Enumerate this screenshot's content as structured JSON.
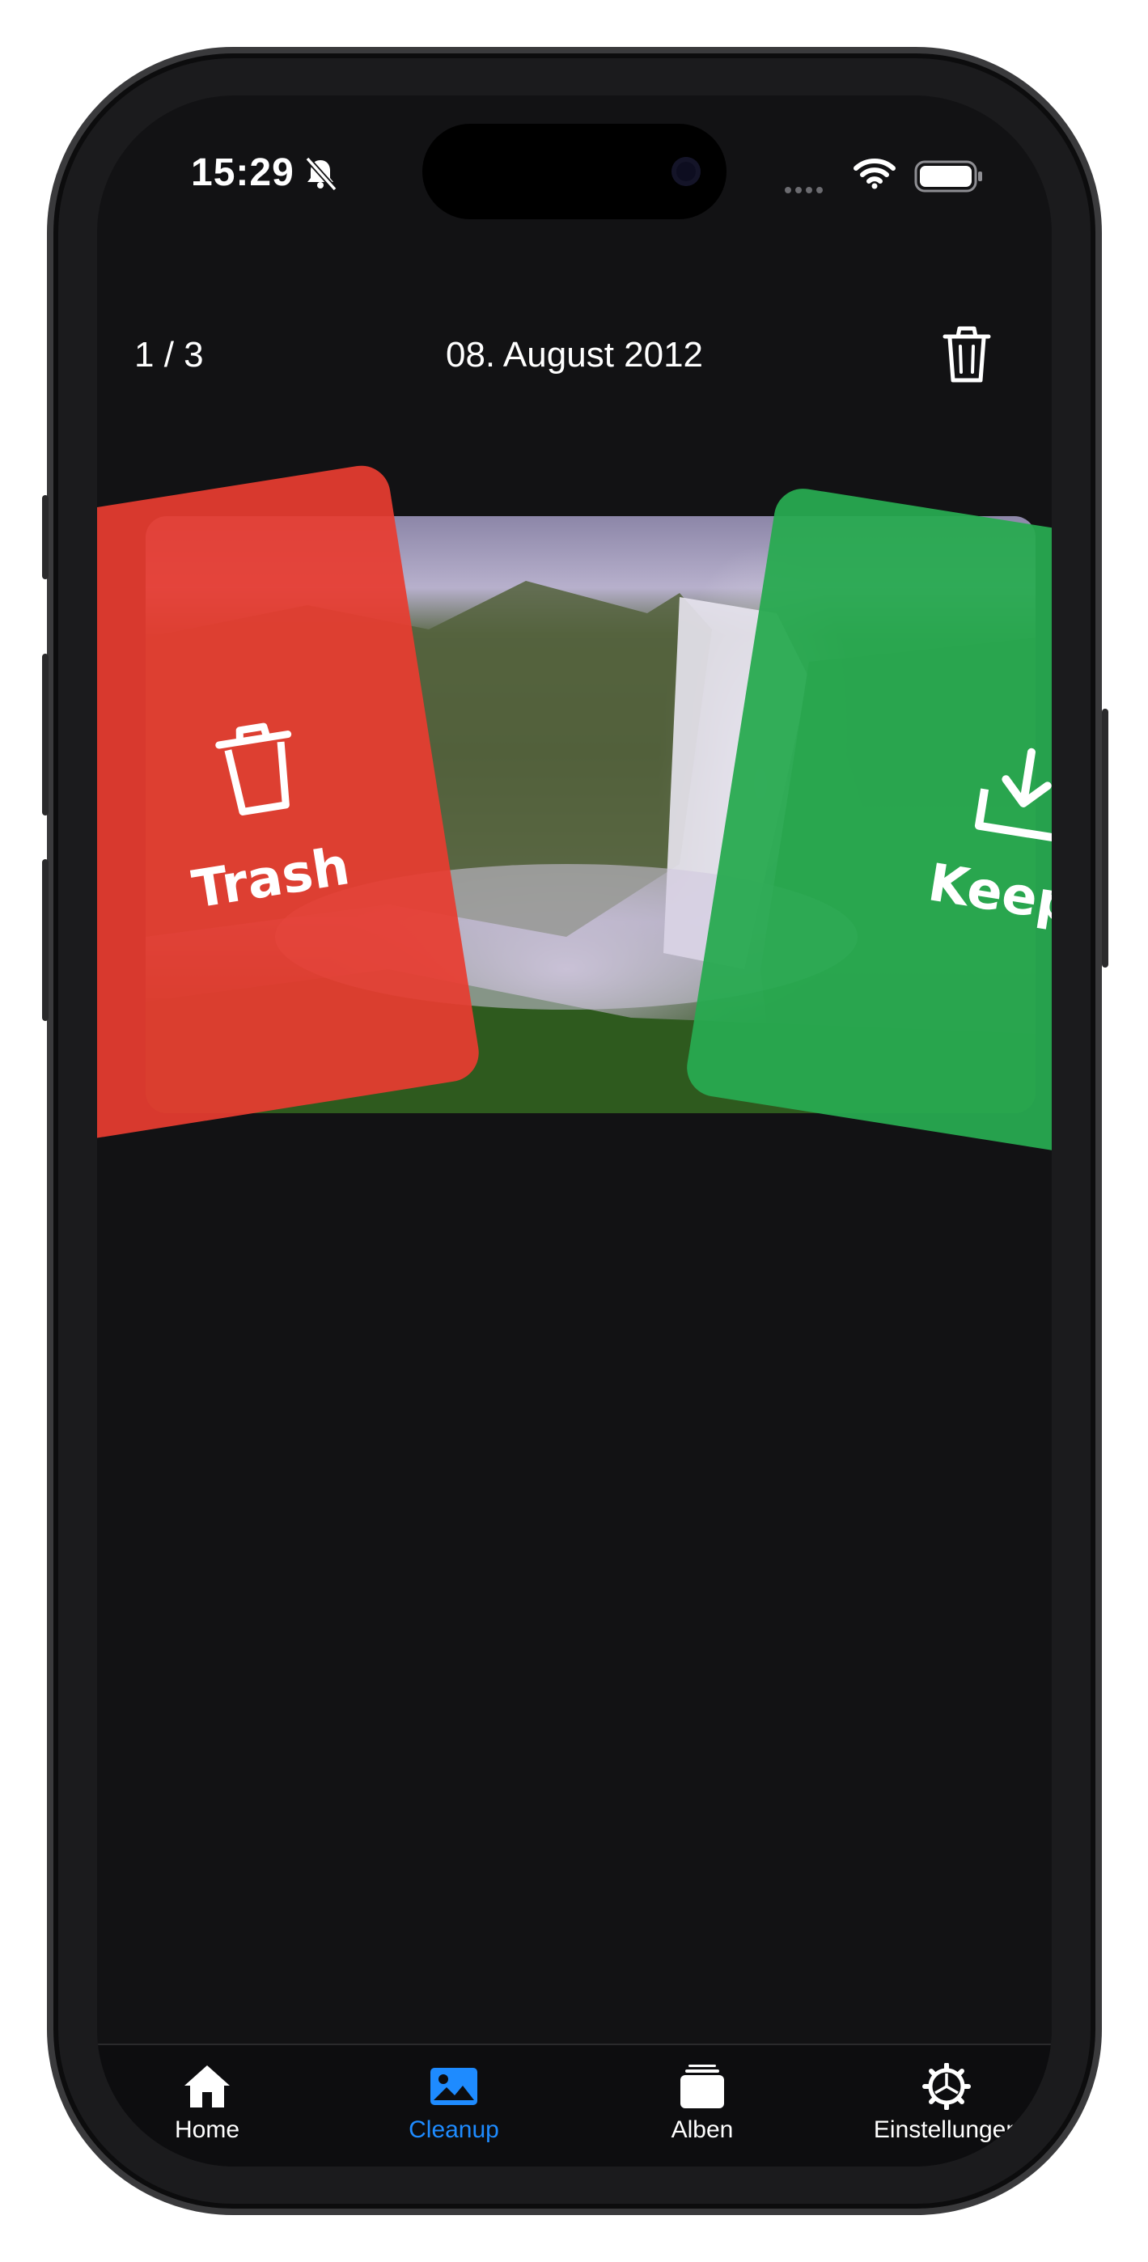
{
  "status_bar": {
    "time": "15:29",
    "icons": [
      "bell-slash-icon",
      "cellular-signal-icon",
      "wifi-icon",
      "battery-icon"
    ]
  },
  "header": {
    "counter": "1 / 3",
    "date": "08. August 2012",
    "trash_icon": "trash-icon"
  },
  "photo": {
    "subject": "waterfall photo"
  },
  "swipe_cards": {
    "trash": {
      "label": "Trash",
      "icon": "trash-icon",
      "color": "#e73c30"
    },
    "keep": {
      "label": "Keep",
      "icon": "download-tray-icon",
      "color": "#28aa50"
    }
  },
  "tab_bar": {
    "tabs": [
      {
        "label": "Home",
        "icon": "house-icon",
        "active": false
      },
      {
        "label": "Cleanup",
        "icon": "photo-icon",
        "active": true
      },
      {
        "label": "Alben",
        "icon": "albums-stack-icon",
        "active": false
      },
      {
        "label": "Einstellungen",
        "icon": "gear-icon",
        "active": false
      }
    ],
    "active_color": "#1e8bff"
  }
}
